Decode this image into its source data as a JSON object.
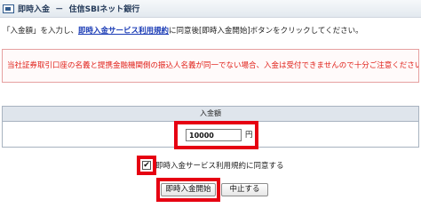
{
  "window": {
    "title": "即時入金",
    "subtitle": "住信SBIネット銀行",
    "separator": "－"
  },
  "instruction": {
    "before": "「入金額」を入力し、",
    "link": "即時入金サービス利用規約",
    "after": "に同意後[即時入金開始]ボタンをクリックしてください。"
  },
  "warning": "当社証券取引口座の名義と提携金融機関側の振込人名義が同一でない場合、入金は受付できませんので十分ご注意ください。",
  "form": {
    "amount_header": "入金額",
    "amount_value": "10000",
    "unit": "円",
    "agree_label": "即時入金サービス利用規約に同意する",
    "agree_checked": true,
    "checkmark": "✔",
    "start_button": "即時入金開始",
    "cancel_button": "中止する"
  },
  "colors": {
    "highlight": "#e60012",
    "warning_text": "#e0221b",
    "link": "#1a3bb5"
  }
}
